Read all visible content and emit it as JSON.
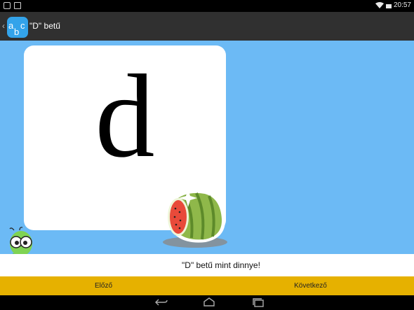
{
  "status_bar": {
    "time": "20:57",
    "icons": [
      "photo-icon",
      "screenshot-icon",
      "wifi-icon",
      "battery-icon"
    ]
  },
  "action_bar": {
    "title": "\"D\" betű",
    "app_icon": "abc-app-icon",
    "app_icon_text": "abc"
  },
  "card": {
    "letter": "d",
    "picture": "watermelon-illustration"
  },
  "mascot": "bookworm-illustration",
  "caption": {
    "text": "\"D\" betű mint dinnye!"
  },
  "navigation": {
    "prev_label": "Előző",
    "next_label": "Következő"
  },
  "system_nav": {
    "icons": [
      "back-icon",
      "home-icon",
      "recents-icon"
    ]
  },
  "colors": {
    "content_background": "#6cbaf5",
    "action_bar": "#303030",
    "nav_buttons": "#e6b100",
    "app_icon": "#33a3ea"
  }
}
